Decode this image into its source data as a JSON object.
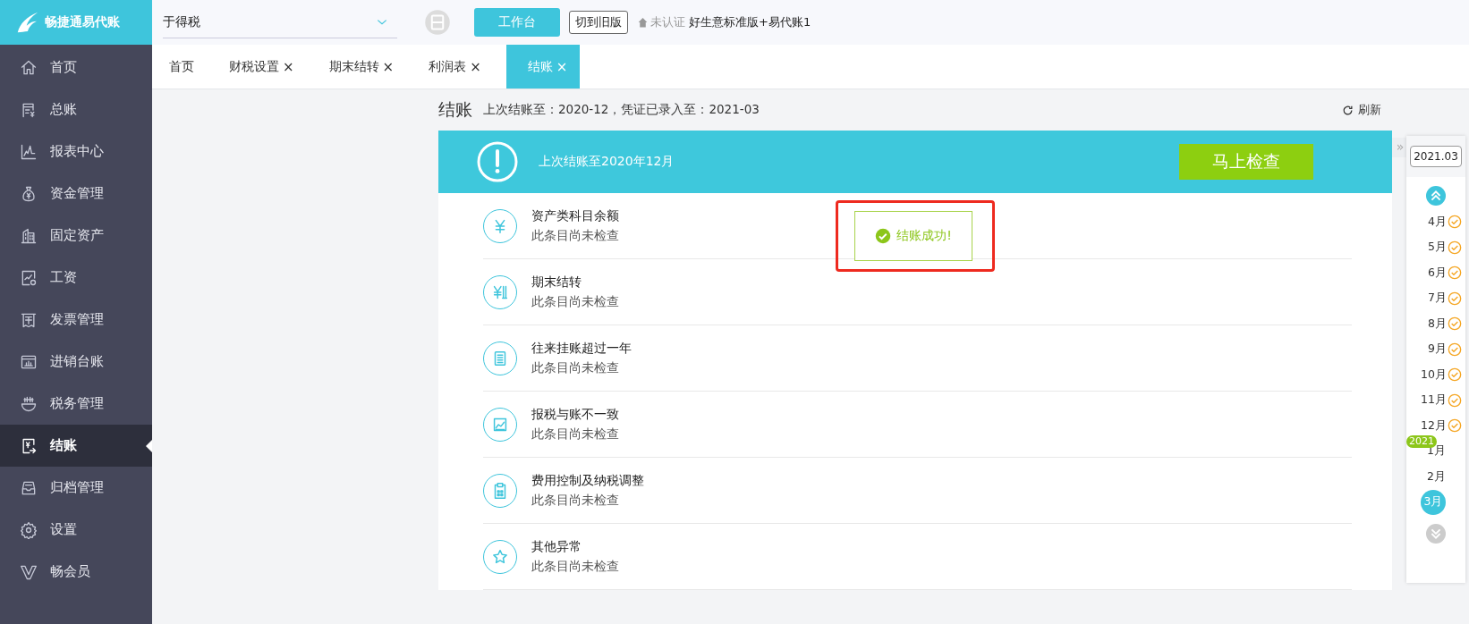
{
  "logo": {
    "text": "畅捷通易代账"
  },
  "sidebar": {
    "items": [
      {
        "label": "首页",
        "kind": "home",
        "selected": false
      },
      {
        "label": "总账",
        "kind": "ledger",
        "selected": false
      },
      {
        "label": "报表中心",
        "kind": "chart",
        "selected": false
      },
      {
        "label": "资金管理",
        "kind": "moneybag",
        "selected": false
      },
      {
        "label": "固定资产",
        "kind": "building",
        "selected": false
      },
      {
        "label": "工资",
        "kind": "payroll",
        "selected": false
      },
      {
        "label": "发票管理",
        "kind": "invoice",
        "selected": false
      },
      {
        "label": "进销台账",
        "kind": "inventory",
        "selected": false
      },
      {
        "label": "税务管理",
        "kind": "tax",
        "selected": false
      },
      {
        "label": "结账",
        "kind": "closing",
        "selected": true
      },
      {
        "label": "归档管理",
        "kind": "archive",
        "selected": false
      },
      {
        "label": "设置",
        "kind": "gear",
        "selected": false
      },
      {
        "label": "畅会员",
        "kind": "vip",
        "selected": false
      }
    ]
  },
  "topbar": {
    "company": "于得税",
    "workbench_button": "工作台",
    "switch_button": "切到旧版",
    "certification": "未认证",
    "edition": "好生意标准版+易代账1"
  },
  "tabs": [
    {
      "label": "首页",
      "closable": false,
      "selected": false
    },
    {
      "label": "财税设置",
      "closable": true,
      "selected": false
    },
    {
      "label": "期末结转",
      "closable": true,
      "selected": false
    },
    {
      "label": "利润表",
      "closable": true,
      "selected": false
    },
    {
      "label": "结账",
      "closable": true,
      "selected": true
    }
  ],
  "close_glyph": "×",
  "page": {
    "title": "结账",
    "info": "上次结账至：2020-12，凭证已录入至：2021-03",
    "refresh": "刷新"
  },
  "banner": {
    "message": "上次结账至2020年12月",
    "button": "马上检查"
  },
  "checks": [
    {
      "kind": "yen",
      "title": "资产类科目余额",
      "status": "此条目尚未检查"
    },
    {
      "kind": "ledger",
      "title": "期末结转",
      "status": "此条目尚未检查"
    },
    {
      "kind": "list",
      "title": "往来挂账超过一年",
      "status": "此条目尚未检查"
    },
    {
      "kind": "chart",
      "title": "报税与账不一致",
      "status": "此条目尚未检查"
    },
    {
      "kind": "clipboard",
      "title": "费用控制及纳税调整",
      "status": "此条目尚未检查"
    },
    {
      "kind": "star",
      "title": "其他异常",
      "status": "此条目尚未检查"
    }
  ],
  "toast": {
    "message": "结账成功!",
    "highlighted": true
  },
  "period_rail": {
    "current": "2021.03",
    "collapse_glyph": "»",
    "months": [
      {
        "label": "4月",
        "checked": true,
        "selected": false
      },
      {
        "label": "5月",
        "checked": true,
        "selected": false
      },
      {
        "label": "6月",
        "checked": true,
        "selected": false
      },
      {
        "label": "7月",
        "checked": true,
        "selected": false
      },
      {
        "label": "8月",
        "checked": true,
        "selected": false
      },
      {
        "label": "9月",
        "checked": true,
        "selected": false
      },
      {
        "label": "10月",
        "checked": true,
        "selected": false
      },
      {
        "label": "11月",
        "checked": true,
        "selected": false
      },
      {
        "label": "12月",
        "checked": true,
        "selected": false
      },
      {
        "label": "1月",
        "checked": false,
        "selected": false,
        "year": "2021"
      },
      {
        "label": "2月",
        "checked": false,
        "selected": false
      },
      {
        "label": "3月",
        "checked": false,
        "selected": true
      }
    ]
  }
}
